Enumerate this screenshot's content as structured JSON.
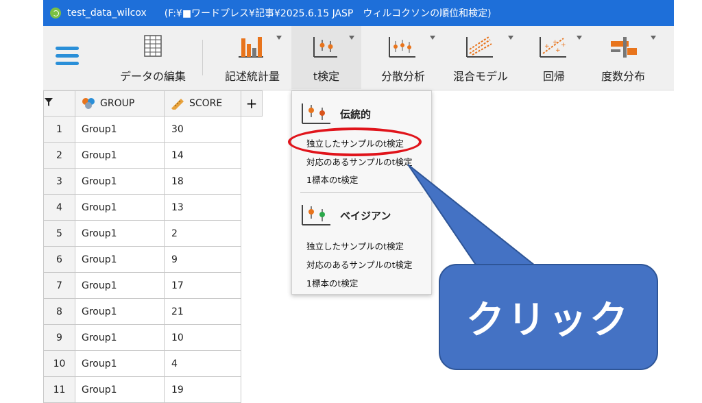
{
  "titlebar": {
    "file_name": "test_data_wilcox",
    "path": "(F:¥■ワードプレス¥記事¥2025.6.15 JASP　ウィルコクソンの順位和検定)"
  },
  "toolbar": {
    "items": [
      {
        "label": "データの編集"
      },
      {
        "label": "記述統計量"
      },
      {
        "label": "t検定"
      },
      {
        "label": "分散分析"
      },
      {
        "label": "混合モデル"
      },
      {
        "label": "回帰"
      },
      {
        "label": "度数分布"
      }
    ]
  },
  "grid": {
    "columns": [
      "GROUP",
      "SCORE"
    ],
    "add_column": "+",
    "rows": [
      {
        "n": "1",
        "group": "Group1",
        "score": "30"
      },
      {
        "n": "2",
        "group": "Group1",
        "score": "14"
      },
      {
        "n": "3",
        "group": "Group1",
        "score": "18"
      },
      {
        "n": "4",
        "group": "Group1",
        "score": "13"
      },
      {
        "n": "5",
        "group": "Group1",
        "score": "2"
      },
      {
        "n": "6",
        "group": "Group1",
        "score": "9"
      },
      {
        "n": "7",
        "group": "Group1",
        "score": "17"
      },
      {
        "n": "8",
        "group": "Group1",
        "score": "21"
      },
      {
        "n": "9",
        "group": "Group1",
        "score": "10"
      },
      {
        "n": "10",
        "group": "Group1",
        "score": "4"
      },
      {
        "n": "11",
        "group": "Group1",
        "score": "19"
      }
    ]
  },
  "menu": {
    "classical": {
      "title": "伝統的",
      "items": [
        "独立したサンプルのt検定",
        "対応のあるサンプルのt検定",
        "1標本のt検定"
      ]
    },
    "bayesian": {
      "title": "ベイジアン",
      "items": [
        "独立したサンプルのt検定",
        "対応のあるサンプルのt検定",
        "1標本のt検定"
      ]
    }
  },
  "callout": {
    "text": "クリック"
  },
  "colors": {
    "titlebar": "#1e6fd9",
    "callout": "#4472c4",
    "highlight": "#e0141b",
    "accent_blue": "#2a8fd8",
    "orange": "#e8741c"
  }
}
